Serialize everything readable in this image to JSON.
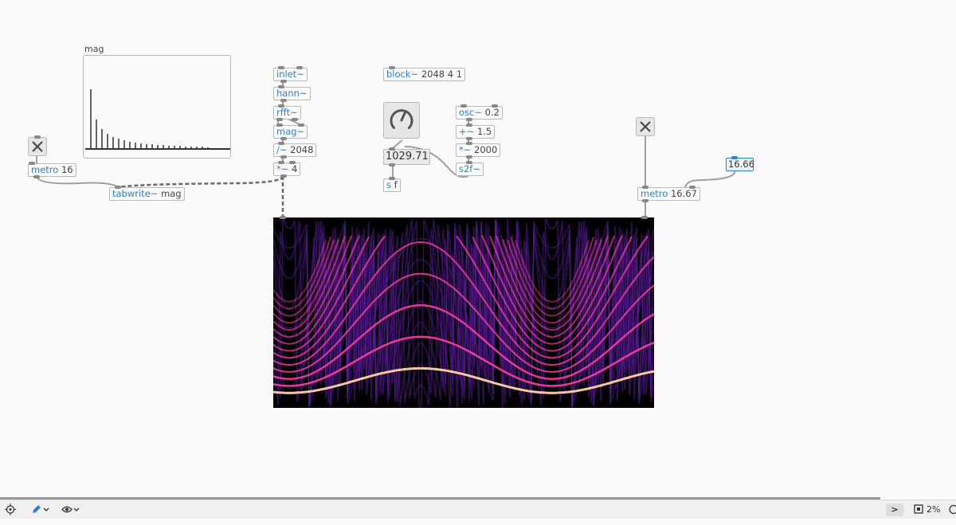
{
  "objects": {
    "inlet": {
      "name": "inlet~",
      "args": ""
    },
    "hann": {
      "name": "hann~",
      "args": ""
    },
    "rfft": {
      "name": "rfft~",
      "args": ""
    },
    "mag": {
      "name": "mag~",
      "args": ""
    },
    "div": {
      "name": "/~",
      "args": "2048"
    },
    "mul": {
      "name": "*~",
      "args": "4"
    },
    "block": {
      "name": "block~",
      "args": "2048 4 1"
    },
    "osc": {
      "name": "osc~",
      "args": "0.2"
    },
    "plus": {
      "name": "+~",
      "args": "1.5"
    },
    "times": {
      "name": "*~",
      "args": "2000"
    },
    "s2f": {
      "name": "s2f~",
      "args": ""
    },
    "send": {
      "name": "s",
      "args": "f"
    },
    "metro_left": {
      "name": "metro",
      "args": "16"
    },
    "tabwrite": {
      "name": "tabwrite~",
      "args": "mag"
    },
    "metro_right": {
      "name": "metro",
      "args": "16.67"
    }
  },
  "number_box": {
    "value": "1029.71"
  },
  "float_box": {
    "value": "16.66"
  },
  "graph": {
    "label": "mag"
  },
  "status": {
    "zoom": "2%",
    "console_glyph": ">"
  },
  "colors": {
    "accent": "#2f7fd0",
    "wire": "#a0a0a0",
    "signal_wire": "#7a7a7a",
    "spectro_bright": "#ffd0a0",
    "spectro_mid": "#ff3fa0",
    "spectro_dim": "#5a1a9a"
  }
}
